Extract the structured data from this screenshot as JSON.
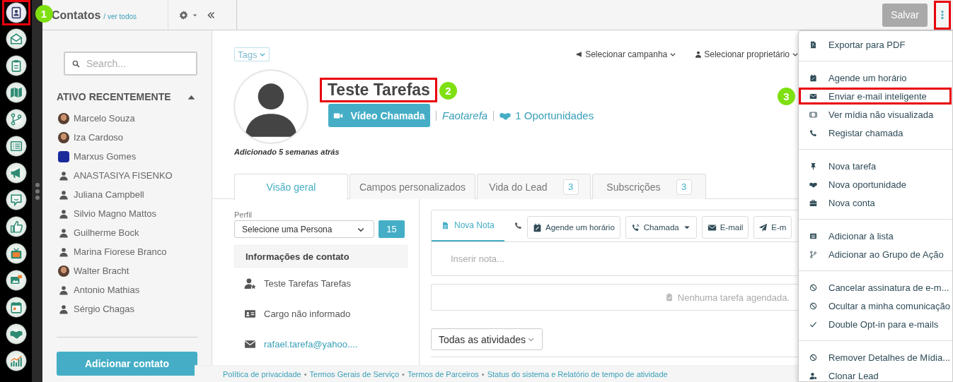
{
  "rail": [
    {
      "selected": true,
      "highlighted": true,
      "callout": "1"
    },
    {
      "selected": false,
      "highlighted": false
    },
    {
      "selected": false,
      "highlighted": false
    },
    {
      "selected": false,
      "highlighted": false
    },
    {
      "selected": false,
      "highlighted": false
    },
    {
      "selected": false,
      "highlighted": false
    },
    {
      "selected": false,
      "highlighted": false
    },
    {
      "selected": false,
      "highlighted": false
    },
    {
      "selected": false,
      "highlighted": false
    },
    {
      "selected": false,
      "highlighted": false
    },
    {
      "selected": false,
      "highlighted": false
    },
    {
      "selected": false,
      "highlighted": false
    },
    {
      "selected": false,
      "highlighted": false
    },
    {
      "selected": false,
      "highlighted": false
    }
  ],
  "header": {
    "title": "Contatos",
    "view_all": "/ ver todos",
    "save": "Salvar",
    "more_highlighted": true
  },
  "sidebar": {
    "search_placeholder": "Search...",
    "section": "ATIVO RECENTEMENTE",
    "expanded": true,
    "add_button": "Adicionar contato",
    "contacts": [
      {
        "name": "Marcelo Souza",
        "kind": "photo"
      },
      {
        "name": "Iza Cardoso",
        "kind": "photo"
      },
      {
        "name": "Marxus Gomes",
        "kind": "logo"
      },
      {
        "name": "ANASTASIYA FISENKO",
        "kind": "person"
      },
      {
        "name": "Juliana Campbell",
        "kind": "person"
      },
      {
        "name": "Silvio Magno Mattos",
        "kind": "person"
      },
      {
        "name": "Guilherme Bock",
        "kind": "person"
      },
      {
        "name": "Marina Fiorese Branco",
        "kind": "person"
      },
      {
        "name": "Walter Bracht",
        "kind": "photo"
      },
      {
        "name": "Antonio Mathias",
        "kind": "person"
      },
      {
        "name": "Sérgio Chagas",
        "kind": "person"
      }
    ]
  },
  "contact": {
    "tags": "Tags",
    "campaign": "Selecionar campanha",
    "owner": "Selecionar proprietário",
    "name": "Teste Tarefas",
    "name_highlighted": true,
    "name_callout": "2",
    "video_button": "Vídeo Chamada",
    "task_link": "Faotarefa",
    "opportunities": "1 Oportunidades",
    "added": "Adicionado 5 semanas atrás"
  },
  "tabs": [
    {
      "label": "Visão geral",
      "selected": true
    },
    {
      "label": "Campos personalizados",
      "selected": false
    },
    {
      "label": "Vida do Lead",
      "count": "3",
      "selected": false
    },
    {
      "label": "Subscrições",
      "count": "3",
      "selected": false
    }
  ],
  "profile": {
    "label": "Perfil",
    "persona": "Selecione uma Persona",
    "score": "15",
    "section": "Informações de contato",
    "rows": [
      {
        "kind": "name",
        "text": "Teste Tarefas Tarefas"
      },
      {
        "kind": "job",
        "text": "Cargo não informado"
      },
      {
        "kind": "email",
        "text": "rafael.tarefa@yahoo...."
      }
    ]
  },
  "notes": {
    "tabs": [
      {
        "kind": "note",
        "label": "Nova Nota",
        "selected": true
      },
      {
        "kind": "call",
        "selected": false
      }
    ],
    "actions": [
      {
        "kind": "schedule",
        "label": "Agende um horário"
      },
      {
        "kind": "call",
        "label": "Chamada",
        "dropdown": true
      },
      {
        "kind": "email",
        "label": "E-mail"
      },
      {
        "kind": "send",
        "label": "E-m"
      }
    ],
    "placeholder": "Inserir nota...",
    "no_tasks": "Nenhuma tarefa agendada.",
    "filter": "Todas as atividades"
  },
  "menu": {
    "callout": "3",
    "groups": [
      [
        {
          "label": "Exportar para PDF",
          "highlighted": false
        }
      ],
      [
        {
          "label": "Agende um horário",
          "highlighted": false
        },
        {
          "label": "Enviar e-mail inteligente",
          "highlighted": true
        },
        {
          "label": "Ver mídia não visualizada",
          "highlighted": false
        },
        {
          "label": "Registar chamada",
          "highlighted": false
        }
      ],
      [
        {
          "label": "Nova tarefa",
          "highlighted": false
        },
        {
          "label": "Nova oportunidade",
          "highlighted": false
        },
        {
          "label": "Nova conta",
          "highlighted": false
        }
      ],
      [
        {
          "label": "Adicionar à lista",
          "highlighted": false
        },
        {
          "label": "Adicionar ao Grupo de Ação",
          "highlighted": false
        }
      ],
      [
        {
          "label": "Cancelar assinatura de e-m...",
          "highlighted": false
        },
        {
          "label": "Ocultar a minha comunicação",
          "highlighted": false
        },
        {
          "label": "Double Opt-in para e-mails",
          "highlighted": false
        }
      ],
      [
        {
          "label": "Remover Detalhes de Mídia...",
          "highlighted": false
        },
        {
          "label": "Clonar Lead",
          "highlighted": false
        }
      ]
    ]
  },
  "footer": {
    "separator": "•",
    "links": [
      "Política de privacidade",
      "Termos Gerais de Serviço",
      "Termos de Parceiros",
      "Status do sistema e Relatório de tempo de atividade"
    ]
  }
}
